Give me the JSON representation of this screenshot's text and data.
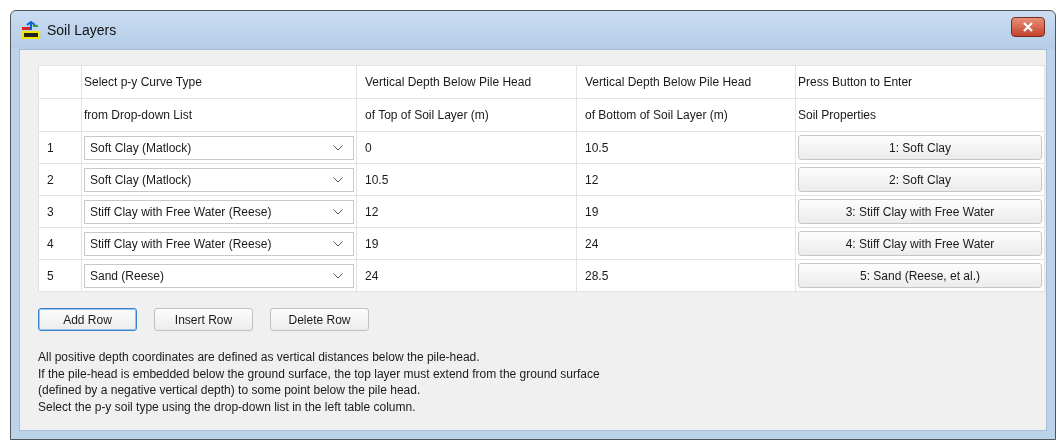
{
  "window": {
    "title": "Soil Layers"
  },
  "table": {
    "columns": [
      {},
      {
        "line_1": "Select p-y Curve Type",
        "line_2": "from Drop-down List"
      },
      {
        "line_1": "Vertical Depth Below Pile Head",
        "line_2": "of Top of Soil Layer (m)"
      },
      {
        "line_1": "Vertical Depth Below Pile Head",
        "line_2": "of Bottom of Soil Layer (m)"
      },
      {
        "line_1": "Press Button to Enter",
        "line_2": "Soil Properties"
      }
    ],
    "rows": [
      {
        "number": "1",
        "curve_type": "Soft Clay (Matlock)",
        "top_depth": "0",
        "bottom_depth": "10.5",
        "properties_button": "1: Soft Clay"
      },
      {
        "number": "2",
        "curve_type": "Soft Clay (Matlock)",
        "top_depth": "10.5",
        "bottom_depth": "12",
        "properties_button": "2: Soft Clay"
      },
      {
        "number": "3",
        "curve_type": "Stiff Clay with Free Water (Reese)",
        "top_depth": "12",
        "bottom_depth": "19",
        "properties_button": "3: Stiff Clay with Free Water"
      },
      {
        "number": "4",
        "curve_type": "Stiff Clay with Free Water (Reese)",
        "top_depth": "19",
        "bottom_depth": "24",
        "properties_button": "4: Stiff Clay with Free Water"
      },
      {
        "number": "5",
        "curve_type": "Sand (Reese)",
        "top_depth": "24",
        "bottom_depth": "28.5",
        "properties_button": "5: Sand (Reese, et al.)"
      }
    ]
  },
  "buttons": [
    {
      "label": "Add Row",
      "focused": true
    },
    {
      "label": "Insert Row",
      "focused": false
    },
    {
      "label": "Delete Row",
      "focused": false
    }
  ],
  "notes": [
    "All positive depth coordinates are defined as vertical distances below the pile-head.",
    "If the pile-head is embedded below the ground surface, the top layer must extend from the ground surface",
    "(defined by a negative vertical depth) to some point below the pile head.",
    "Select the p-y soil type using the drop-down list in the left table column."
  ]
}
